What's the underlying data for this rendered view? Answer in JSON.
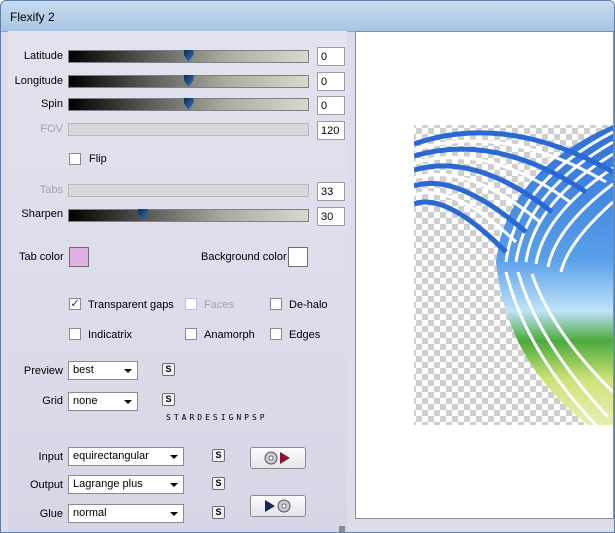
{
  "window": {
    "title": "Flexify 2"
  },
  "sliders": [
    {
      "key": "latitude",
      "label": "Latitude",
      "value": "0",
      "position": 0.5,
      "enabled": true
    },
    {
      "key": "longitude",
      "label": "Longitude",
      "value": "0",
      "position": 0.5,
      "enabled": true
    },
    {
      "key": "spin",
      "label": "Spin",
      "value": "0",
      "position": 0.5,
      "enabled": true
    },
    {
      "key": "fov",
      "label": "FOV",
      "value": "120",
      "enabled": false
    },
    {
      "key": "tabs",
      "label": "Tabs",
      "value": "33",
      "enabled": false
    },
    {
      "key": "sharpen",
      "label": "Sharpen",
      "value": "30",
      "position": 0.3,
      "enabled": true
    }
  ],
  "flip": {
    "label": "Flip",
    "checked": false
  },
  "colors": {
    "tab_color_label": "Tab color",
    "tab_color": "#e0b0e0",
    "background_color_label": "Background color",
    "background_color": "#ffffff"
  },
  "options": {
    "transparent_gaps": {
      "label": "Transparent gaps",
      "checked": true,
      "enabled": true
    },
    "faces": {
      "label": "Faces",
      "checked": false,
      "enabled": false
    },
    "de_halo": {
      "label": "De-halo",
      "checked": false,
      "enabled": true
    },
    "indicatrix": {
      "label": "Indicatrix",
      "checked": false,
      "enabled": true
    },
    "anamorph": {
      "label": "Anamorph",
      "checked": false,
      "enabled": true
    },
    "edges": {
      "label": "Edges",
      "checked": false,
      "enabled": true
    }
  },
  "preview": {
    "label": "Preview",
    "value": "best",
    "s_label": "S"
  },
  "grid": {
    "label": "Grid",
    "value": "none",
    "s_label": "S"
  },
  "brand_text": "STARDESIGNPSP",
  "input": {
    "label": "Input",
    "value": "equirectangular",
    "s_label": "S"
  },
  "output": {
    "label": "Output",
    "value": "Lagrange plus",
    "s_label": "S"
  },
  "glue": {
    "label": "Glue",
    "value": "normal",
    "s_label": "S"
  }
}
